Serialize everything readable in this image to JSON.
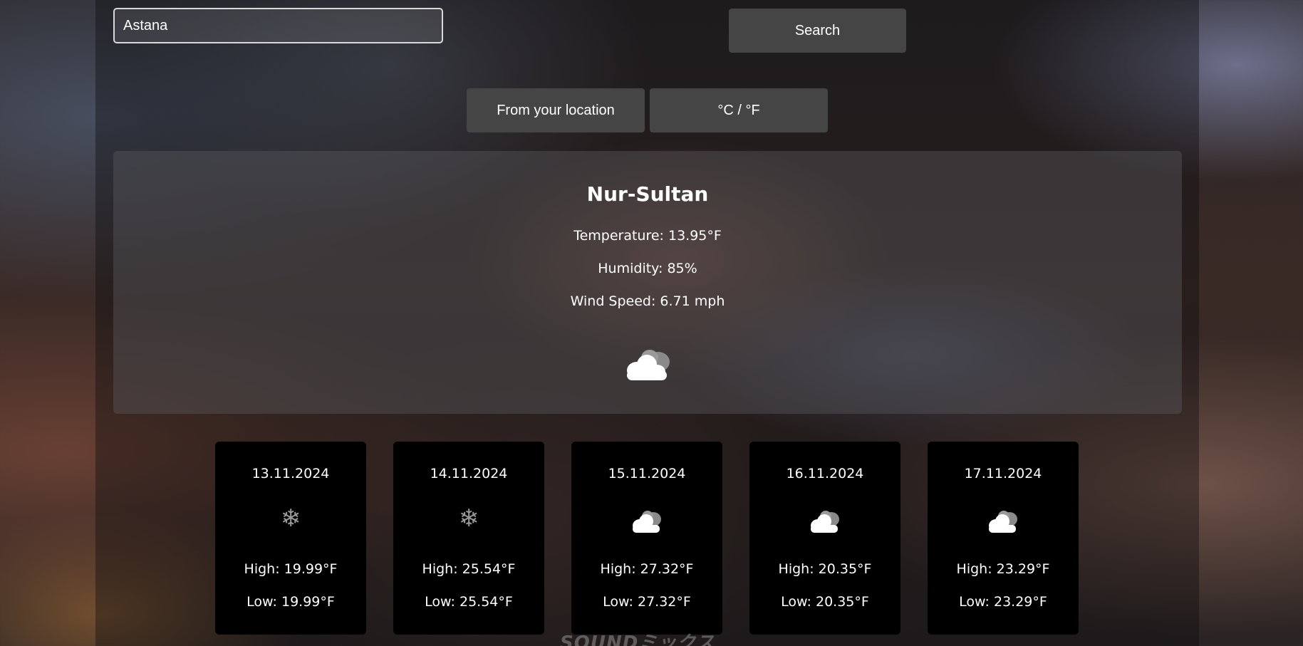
{
  "search": {
    "value": "Astana",
    "button_label": "Search"
  },
  "controls": {
    "location_label": "From your location",
    "unit_label": "°C / °F"
  },
  "current": {
    "city": "Nur-Sultan",
    "temperature": "Temperature: 13.95°F",
    "humidity": "Humidity: 85%",
    "wind": "Wind Speed: 6.71 mph",
    "icon": "cloud-icon"
  },
  "forecast": [
    {
      "date": "13.11.2024",
      "icon": "snowflake-icon",
      "high": "High: 19.99°F",
      "low": "Low: 19.99°F"
    },
    {
      "date": "14.11.2024",
      "icon": "snowflake-icon",
      "high": "High: 25.54°F",
      "low": "Low: 25.54°F"
    },
    {
      "date": "15.11.2024",
      "icon": "cloud-icon",
      "high": "High: 27.32°F",
      "low": "Low: 27.32°F"
    },
    {
      "date": "16.11.2024",
      "icon": "cloud-icon",
      "high": "High: 20.35°F",
      "low": "Low: 20.35°F"
    },
    {
      "date": "17.11.2024",
      "icon": "cloud-icon",
      "high": "High: 23.29°F",
      "low": "Low: 23.29°F"
    }
  ],
  "watermark": "SOUNDミックス",
  "colors": {
    "button_bg": "#454545",
    "card_bg": "#000000",
    "text": "#ffffff"
  }
}
